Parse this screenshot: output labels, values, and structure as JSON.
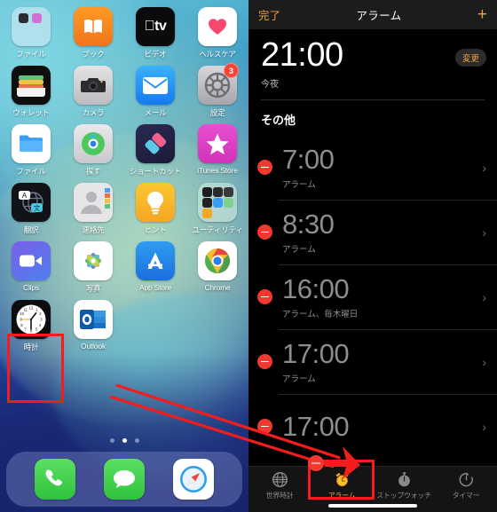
{
  "home_screen": {
    "apps": [
      {
        "label": "ファイル",
        "icon": "folder-icon",
        "type": "folder"
      },
      {
        "label": "ブック",
        "icon": "books-icon",
        "type": "app"
      },
      {
        "label": "ビデオ",
        "icon": "apple-tv-icon",
        "type": "app"
      },
      {
        "label": "ヘルスケア",
        "icon": "health-icon",
        "type": "app"
      },
      {
        "label": "ウォレット",
        "icon": "wallet-icon",
        "type": "app"
      },
      {
        "label": "カメラ",
        "icon": "camera-icon",
        "type": "app"
      },
      {
        "label": "メール",
        "icon": "mail-icon",
        "type": "app"
      },
      {
        "label": "設定",
        "icon": "settings-gear-icon",
        "type": "app",
        "badge": "3"
      },
      {
        "label": "ファイル",
        "icon": "files-folder-icon",
        "type": "app"
      },
      {
        "label": "探す",
        "icon": "find-my-icon",
        "type": "app"
      },
      {
        "label": "ショートカット",
        "icon": "shortcuts-icon",
        "type": "app"
      },
      {
        "label": "iTunes Store",
        "icon": "itunes-store-star-icon",
        "type": "app"
      },
      {
        "label": "翻訳",
        "icon": "translate-icon",
        "type": "app"
      },
      {
        "label": "連絡先",
        "icon": "contacts-icon",
        "type": "app"
      },
      {
        "label": "ヒント",
        "icon": "tips-lightbulb-icon",
        "type": "app"
      },
      {
        "label": "ユーティリティ",
        "icon": "utilities-folder-icon",
        "type": "folder"
      },
      {
        "label": "Clips",
        "icon": "clips-icon",
        "type": "app"
      },
      {
        "label": "写真",
        "icon": "photos-icon",
        "type": "app"
      },
      {
        "label": "App Store",
        "icon": "app-store-icon",
        "type": "app"
      },
      {
        "label": "Chrome",
        "icon": "chrome-icon",
        "type": "app"
      },
      {
        "label": "時計",
        "icon": "clock-icon",
        "type": "app",
        "highlighted": true
      },
      {
        "label": "Outlook",
        "icon": "outlook-icon",
        "type": "app"
      }
    ],
    "dock": [
      {
        "label": "電話",
        "icon": "phone-icon"
      },
      {
        "label": "メッセージ",
        "icon": "messages-icon"
      },
      {
        "label": "Safari",
        "icon": "safari-compass-icon"
      }
    ],
    "page_dots": {
      "count": 3,
      "active_index": 1
    }
  },
  "clock_app": {
    "navbar": {
      "done_label": "完了",
      "title": "アラーム",
      "add_label": "+"
    },
    "tonight": {
      "time": "21:00",
      "sub": "今夜",
      "change_label": "変更"
    },
    "section_header": "その他",
    "alarms": [
      {
        "time": "7:00",
        "sub": "アラーム",
        "delete": "minus-icon",
        "chevron": "chevron-right-icon"
      },
      {
        "time": "8:30",
        "sub": "アラーム",
        "delete": "minus-icon",
        "chevron": "chevron-right-icon"
      },
      {
        "time": "16:00",
        "sub": "アラーム、毎木曜日",
        "delete": "minus-icon",
        "chevron": "chevron-right-icon"
      },
      {
        "time": "17:00",
        "sub": "アラーム",
        "delete": "minus-icon",
        "chevron": "chevron-right-icon"
      },
      {
        "time": "17:00",
        "sub": "",
        "delete": "minus-icon",
        "chevron": "chevron-right-icon"
      }
    ],
    "tabs": [
      {
        "label": "世界時計",
        "icon": "globe-icon",
        "selected": false
      },
      {
        "label": "アラーム",
        "icon": "alarm-clock-icon",
        "selected": true
      },
      {
        "label": "ストップウォッチ",
        "icon": "stopwatch-icon",
        "selected": false
      },
      {
        "label": "タイマー",
        "icon": "timer-icon",
        "selected": false
      }
    ]
  },
  "annotations": {
    "accent_color": "#f41c1c",
    "boxes": [
      "clock-app-icon-highlight",
      "alarm-tab-highlight"
    ],
    "arrow": "arrow-from-clock-icon-to-alarm-tab"
  }
}
